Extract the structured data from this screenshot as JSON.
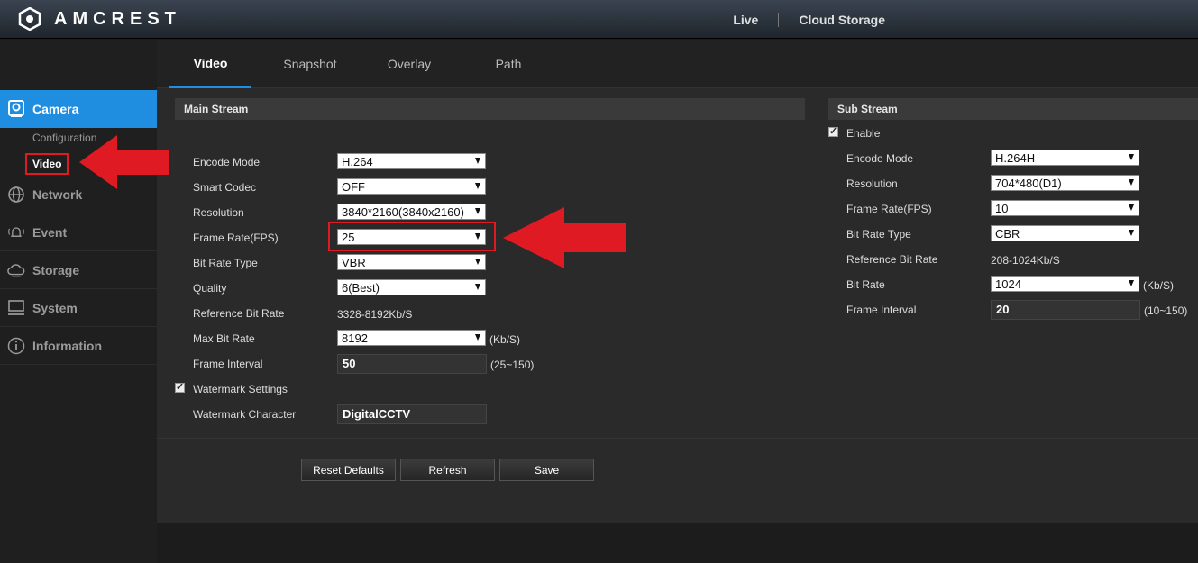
{
  "brand": {
    "name": "AMCREST"
  },
  "topnav": {
    "live": "Live",
    "cloud": "Cloud Storage"
  },
  "sidebar": {
    "items": [
      {
        "label": "Camera",
        "icon": "camera-icon"
      },
      {
        "label": "Network",
        "icon": "globe-icon"
      },
      {
        "label": "Event",
        "icon": "bell-icon"
      },
      {
        "label": "Storage",
        "icon": "cloud-icon"
      },
      {
        "label": "System",
        "icon": "monitor-icon"
      },
      {
        "label": "Information",
        "icon": "info-icon"
      }
    ],
    "sub": {
      "configuration": "Configuration",
      "video": "Video"
    }
  },
  "tabs": [
    "Video",
    "Snapshot",
    "Overlay",
    "Path"
  ],
  "main": {
    "title": "Main Stream",
    "encode_mode_label": "Encode Mode",
    "encode_mode": "H.264",
    "smart_codec_label": "Smart Codec",
    "smart_codec": "OFF",
    "resolution_label": "Resolution",
    "resolution": "3840*2160(3840x2160)",
    "frame_rate_label": "Frame Rate(FPS)",
    "frame_rate": "25",
    "bit_rate_type_label": "Bit Rate Type",
    "bit_rate_type": "VBR",
    "quality_label": "Quality",
    "quality": "6(Best)",
    "ref_bit_rate_label": "Reference Bit Rate",
    "ref_bit_rate": "3328-8192Kb/S",
    "max_bit_rate_label": "Max Bit Rate",
    "max_bit_rate": "8192",
    "max_bit_rate_unit": "(Kb/S)",
    "frame_interval_label": "Frame Interval",
    "frame_interval": "50",
    "frame_interval_range": "(25~150)",
    "watermark_label": "Watermark Settings",
    "watermark_char_label": "Watermark Character",
    "watermark_char": "DigitalCCTV"
  },
  "sub": {
    "title": "Sub Stream",
    "enable_label": "Enable",
    "encode_mode_label": "Encode Mode",
    "encode_mode": "H.264H",
    "resolution_label": "Resolution",
    "resolution": "704*480(D1)",
    "frame_rate_label": "Frame Rate(FPS)",
    "frame_rate": "10",
    "bit_rate_type_label": "Bit Rate Type",
    "bit_rate_type": "CBR",
    "ref_bit_rate_label": "Reference Bit Rate",
    "ref_bit_rate": "208-1024Kb/S",
    "bit_rate_label": "Bit Rate",
    "bit_rate": "1024",
    "bit_rate_unit": "(Kb/S)",
    "frame_interval_label": "Frame Interval",
    "frame_interval": "20",
    "frame_interval_range": "(10~150)"
  },
  "buttons": {
    "reset": "Reset Defaults",
    "refresh": "Refresh",
    "save": "Save"
  },
  "colors": {
    "accent": "#1f8de0",
    "highlight": "#e01a22"
  }
}
